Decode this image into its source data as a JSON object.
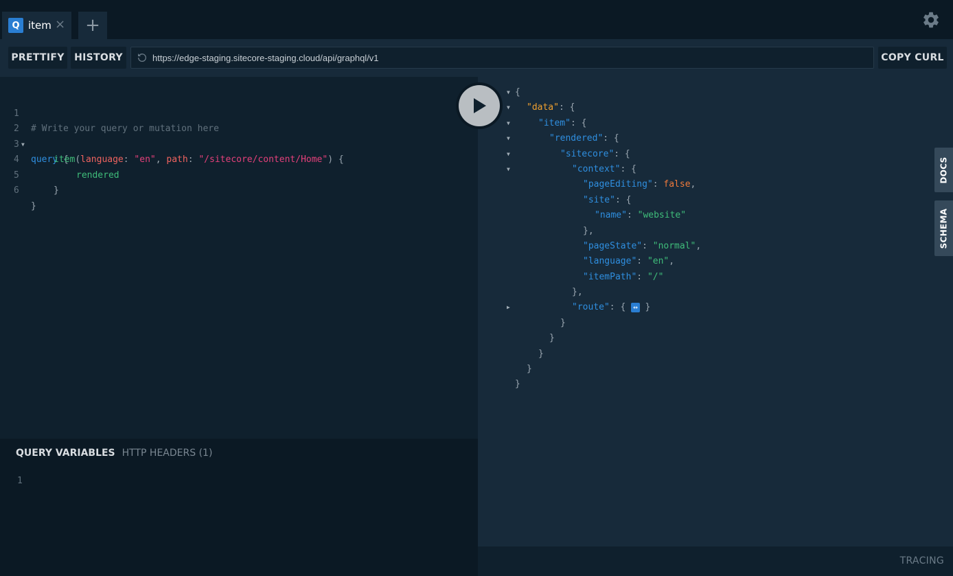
{
  "tabs": [
    {
      "badge": "Q",
      "label": "item",
      "close": "×"
    }
  ],
  "add_tab": "+",
  "toolbar": {
    "prettify_label": "PRETTIFY",
    "history_label": "HISTORY",
    "url": "https://edge-staging.sitecore-staging.cloud/api/graphql/v1",
    "copy_curl_label": "COPY CURL"
  },
  "editor": {
    "line_numbers": [
      "1",
      "2",
      "3",
      "4",
      "5",
      "6"
    ],
    "line1": "# Write your query or mutation here",
    "line2_kw": "query",
    "line2_brace": " {",
    "line3_field": "item",
    "line3_open": "(",
    "line3_arg1": "language",
    "line3_colon1": ": ",
    "line3_val1": "\"en\"",
    "line3_comma": ", ",
    "line3_arg2": "path",
    "line3_colon2": ": ",
    "line3_val2": "\"/sitecore/content/Home\"",
    "line3_close": ") {",
    "line4_field": "rendered",
    "line5": "}",
    "line6": "}"
  },
  "variables": {
    "tab_query_vars": "QUERY VARIABLES",
    "tab_http_headers": "HTTP HEADERS (1)",
    "line_number": "1"
  },
  "result": {
    "open_brace": "{",
    "data_key": "\"data\"",
    "item_key": "\"item\"",
    "rendered_key": "\"rendered\"",
    "sitecore_key": "\"sitecore\"",
    "context_key": "\"context\"",
    "pageEditing_key": "\"pageEditing\"",
    "pageEditing_val": "false",
    "site_key": "\"site\"",
    "name_key": "\"name\"",
    "name_val": "\"website\"",
    "pageState_key": "\"pageState\"",
    "pageState_val": "\"normal\"",
    "language_key": "\"language\"",
    "language_val": "\"en\"",
    "itemPath_key": "\"itemPath\"",
    "itemPath_val": "\"/\"",
    "route_key": "\"route\"",
    "collapsed_badge": "↔",
    "colon_brace": ": {",
    "colon": ": ",
    "comma": ",",
    "close_brace": "}",
    "close_brace_comma": "},"
  },
  "side_tabs": {
    "docs": "DOCS",
    "schema": "SCHEMA"
  },
  "footer": {
    "tracing": "TRACING"
  },
  "colors": {
    "accent": "#2a7ed2",
    "background": "#0f202d",
    "panel": "#172a3a",
    "keyword": "#2f8fe0",
    "field": "#3fbd7a",
    "string": "#e4407a",
    "json_data_key": "#f0a02f",
    "boolean": "#f07a3c"
  },
  "icons": {
    "settings": "gear-icon",
    "refresh": "refresh-icon",
    "run": "play-icon"
  }
}
